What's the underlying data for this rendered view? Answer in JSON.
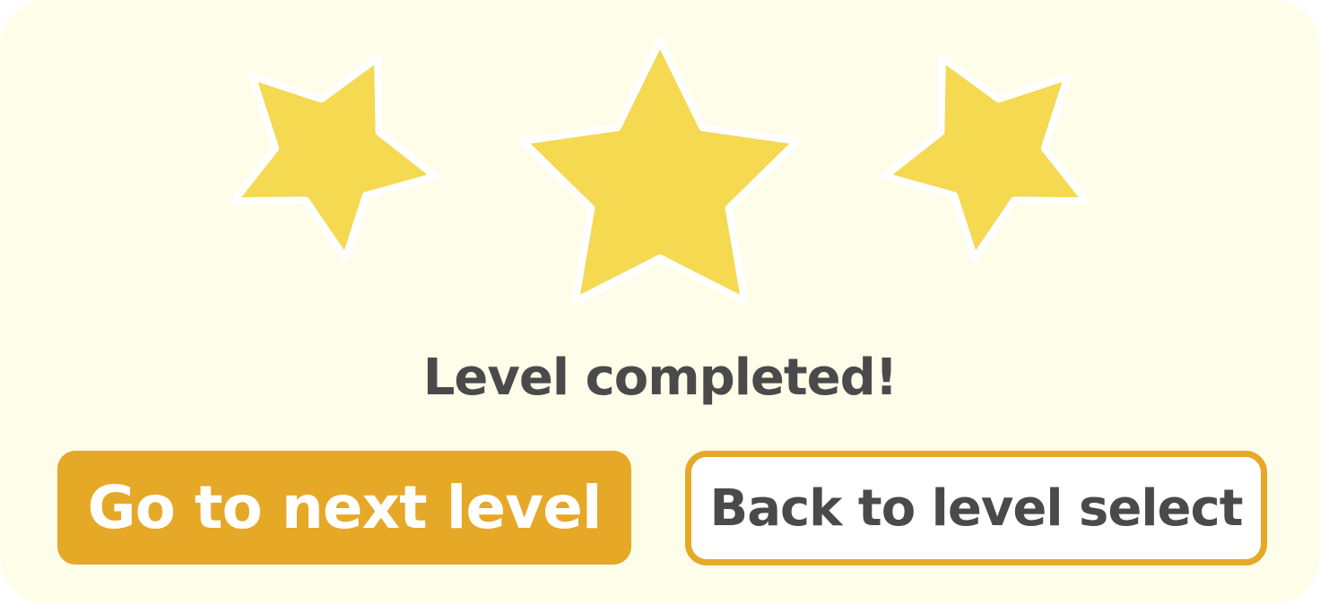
{
  "result": {
    "stars_earned": 3,
    "stars_total": 3,
    "title": "Level completed!"
  },
  "buttons": {
    "next_level_label": "Go to next level",
    "level_select_label": "Back to level select"
  },
  "colors": {
    "panel_background": "#fefdea",
    "star_fill": "#f4d951",
    "star_outline": "#ffffff",
    "accent": "#e6a827",
    "text_dark": "#4a4a4a",
    "text_on_accent": "#ffffff"
  },
  "icons": {
    "star": "star-icon"
  }
}
